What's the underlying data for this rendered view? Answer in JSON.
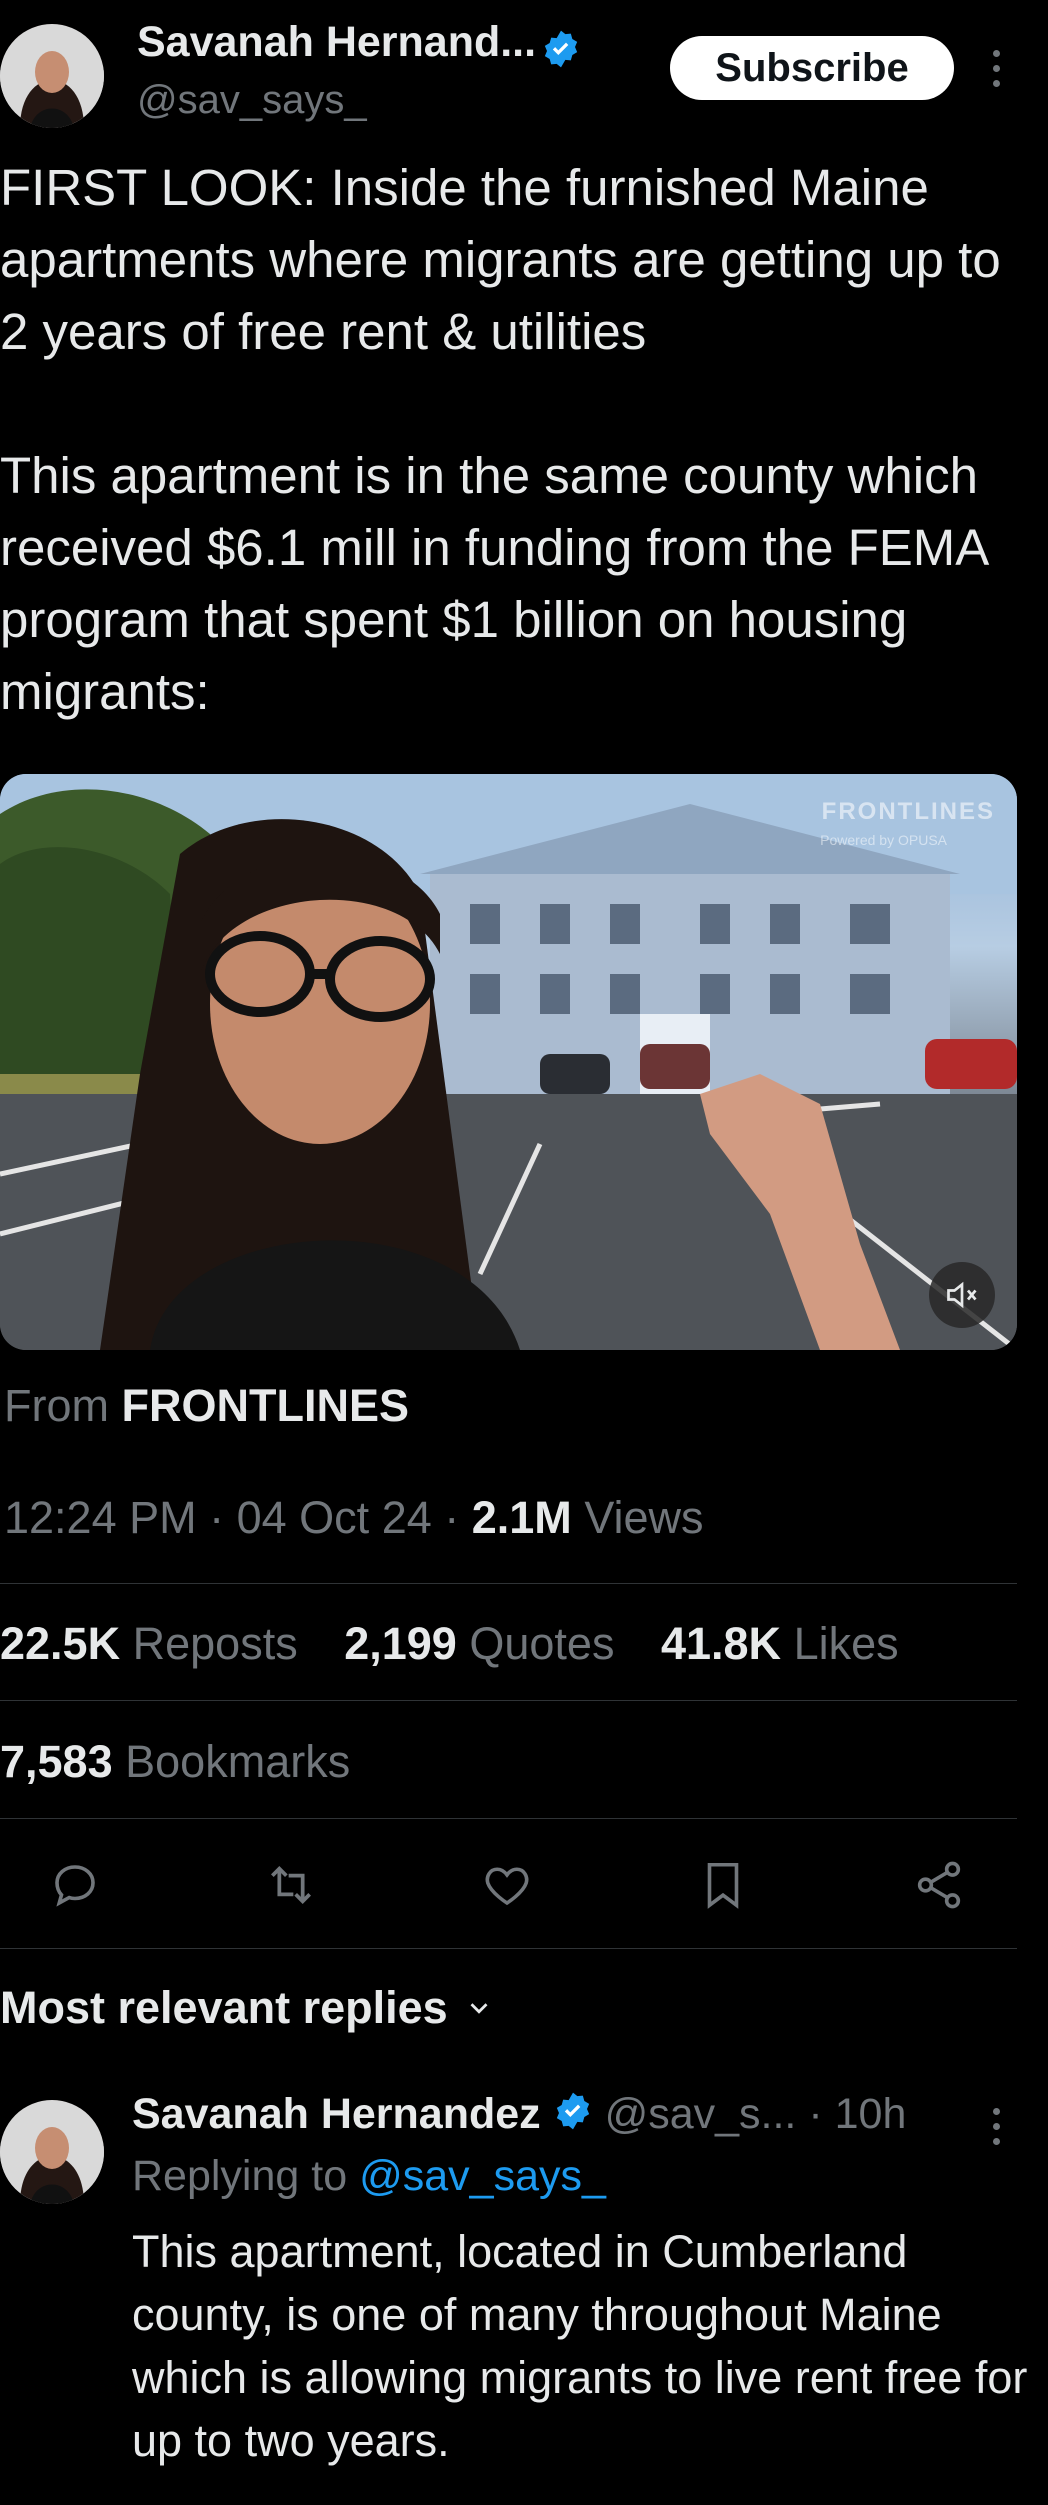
{
  "tweet": {
    "author_name": "Savanah Hernand...",
    "author_handle": "@sav_says_",
    "subscribe_label": "Subscribe",
    "text": "FIRST LOOK: Inside the furnished Maine apartments where migrants are getting up to 2 years of free rent & utilities\n\nThis apartment is in the same county which received $6.1 mill in funding from the FEMA program that spent $1 billion on housing migrants:",
    "from_prefix": "From",
    "from_source": "FRONTLINES",
    "time": "12:24 PM",
    "date": "04 Oct 24",
    "views_count": "2.1M",
    "views_label": "Views",
    "reposts_count": "22.5K",
    "reposts_label": "Reposts",
    "quotes_count": "2,199",
    "quotes_label": "Quotes",
    "likes_count": "41.8K",
    "likes_label": "Likes",
    "bookmarks_count": "7,583",
    "bookmarks_label": "Bookmarks"
  },
  "media": {
    "watermark": "FRONTLINES",
    "watermark_sub": "Powered by OPUSA"
  },
  "actions": [
    "reply-icon",
    "repost-icon",
    "like-icon",
    "bookmark-icon",
    "share-icon"
  ],
  "replies": {
    "section_label": "Most relevant replies",
    "items": [
      {
        "author_name": "Savanah Hernandez",
        "author_handle": "@sav_s...",
        "time": "10h",
        "replying_prefix": "Replying to",
        "replying_to": "@sav_says_",
        "text": "This apartment, located in Cumberland county, is one of many throughout Maine which is allowing migrants to live rent free for up to two years."
      }
    ]
  },
  "colors": {
    "background": "#000000",
    "text": "#e7e9ea",
    "muted": "#71767b",
    "accent": "#1d9bf0",
    "divider": "#2f3336"
  }
}
